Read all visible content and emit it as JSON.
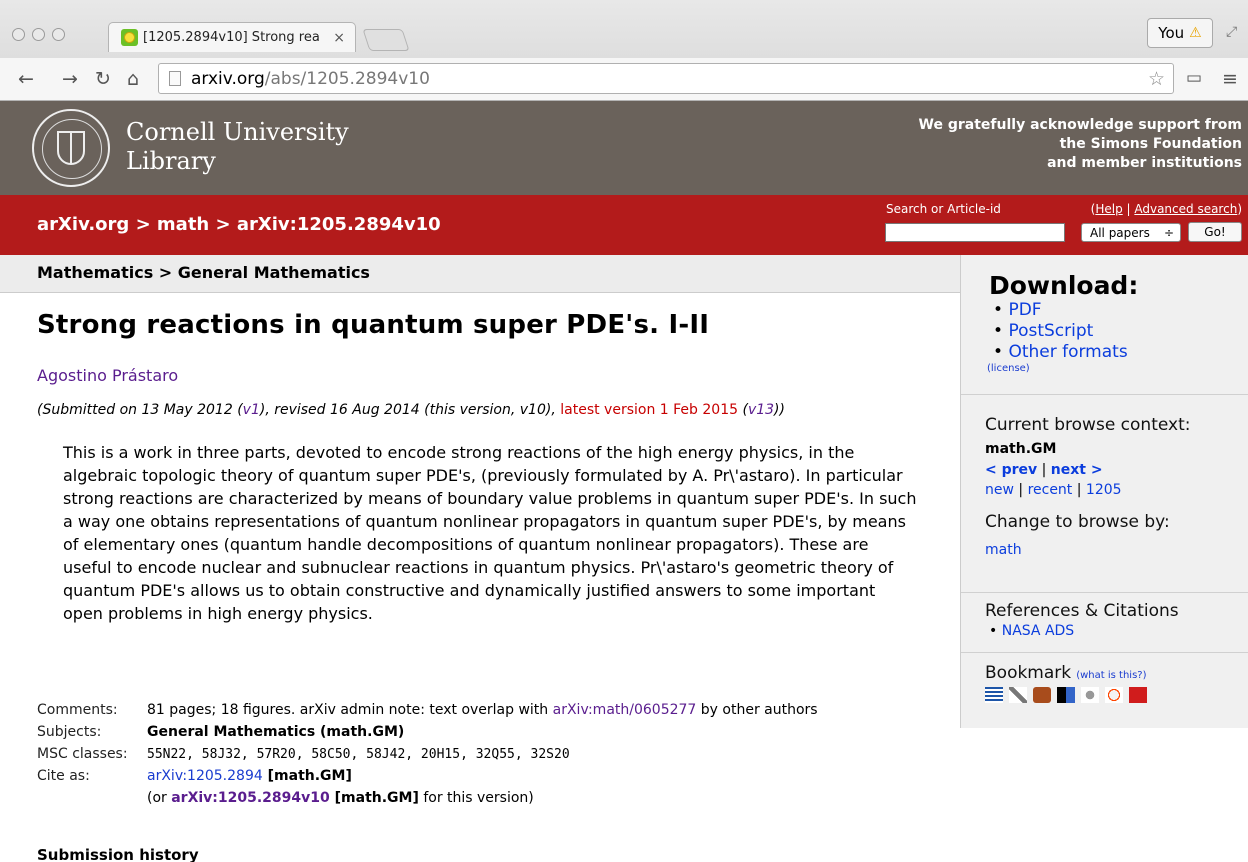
{
  "browser": {
    "tab_title": "[1205.2894v10] Strong rea",
    "tab_close": "×",
    "profile_label": "You",
    "warning_glyph": "⚠",
    "url_host": "arxiv.org",
    "url_path": "/abs/1205.2894v10"
  },
  "header": {
    "library_name_line1": "Cornell University",
    "library_name_line2": "Library",
    "support_line1": "We gratefully acknowledge support from",
    "support_line2": "the Simons Foundation",
    "support_line3": "and member institutions"
  },
  "redbar": {
    "breadcrumb": "arXiv.org > math > arXiv:1205.2894v10",
    "search_label": "Search or Article-id",
    "help_link": "Help",
    "advanced_link": "Advanced search",
    "help_open": "(",
    "help_sep": " | ",
    "help_close": ")",
    "select_value": "All papers",
    "select_arrow": "÷",
    "go_label": "Go!"
  },
  "paper": {
    "subject_header": "Mathematics > General Mathematics",
    "title": "Strong reactions in quantum super PDE's. I-II",
    "author": "Agostino Prástaro",
    "submitted_prefix": "(Submitted on 13 May 2012 (",
    "v1": "v1",
    "revised": "), revised 16 Aug 2014 (this version, v10), ",
    "latest": "latest version 1 Feb 2015",
    "latest_open": " (",
    "v13": "v13",
    "closing": "))",
    "abstract": "This is a work in three parts, devoted to encode strong reactions of the high energy physics, in the algebraic topologic theory of quantum super PDE's, (previously formulated by A. Pr\\'astaro). In particular strong reactions are characterized by means of boundary value problems in quantum super PDE's. In such a way one obtains representations of quantum nonlinear propagators in quantum super PDE's, by means of elementary ones (quantum handle decompositions of quantum nonlinear propagators). These are useful to encode nuclear and subnuclear reactions in quantum physics. Pr\\'astaro's geometric theory of quantum PDE's allows us to obtain constructive and dynamically justified answers to some important open problems in high energy physics.",
    "comments_label": "Comments:",
    "comments_text": "81 pages; 18 figures. arXiv admin note: text overlap with ",
    "comments_link": "arXiv:math/0605277",
    "comments_tail": " by other authors",
    "subjects_label": "Subjects:",
    "subjects_value": "General Mathematics (math.GM)",
    "msc_label": "MSC classes:",
    "msc_value": "55N22, 58J32, 57R20, 58C50, 58J42, 20H15, 32Q55, 32S20",
    "cite_label": "Cite as:",
    "cite_link": "arXiv:1205.2894",
    "cite_tag": " [math.GM]",
    "cite2_prefix": "(or ",
    "cite2_link": "arXiv:1205.2894v10",
    "cite2_tag": " [math.GM]",
    "cite2_tail": " for this version)",
    "history_header": "Submission history"
  },
  "sidebar": {
    "download_header": "Download:",
    "download_links": [
      "PDF",
      "PostScript",
      "Other formats"
    ],
    "license": "(license)",
    "context_header": "Current browse context:",
    "context_value": "math.GM",
    "prev": "< prev",
    "next": "next >",
    "sep": " | ",
    "new": "new",
    "recent": "recent",
    "yymm": "1205",
    "change_header": "Change to browse by:",
    "change_link": "math",
    "refs_header": "References & Citations",
    "refs_link": "NASA ADS",
    "bookmark_header": "Bookmark",
    "bookmark_what": "(what is this?)"
  }
}
